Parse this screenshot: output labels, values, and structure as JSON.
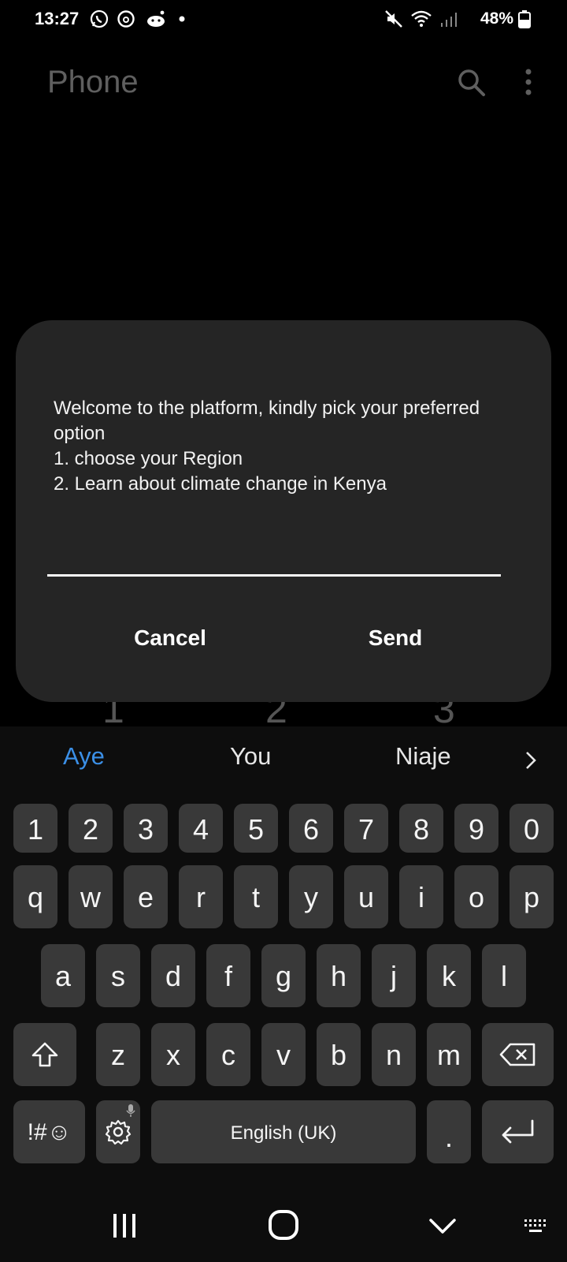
{
  "status_bar": {
    "time": "13:27",
    "battery": "48%"
  },
  "app": {
    "title": "Phone"
  },
  "dialer_digits": [
    "1",
    "2",
    "3"
  ],
  "dialog": {
    "message": "Welcome to the platform, kindly pick your preferred option\n1. choose your Region\n2. Learn about climate change in Kenya",
    "input_value": "",
    "cancel_label": "Cancel",
    "send_label": "Send"
  },
  "keyboard": {
    "suggestions": [
      "Aye",
      "You",
      "Niaje"
    ],
    "number_row": [
      "1",
      "2",
      "3",
      "4",
      "5",
      "6",
      "7",
      "8",
      "9",
      "0"
    ],
    "row1": [
      "q",
      "w",
      "e",
      "r",
      "t",
      "y",
      "u",
      "i",
      "o",
      "p"
    ],
    "row2": [
      "a",
      "s",
      "d",
      "f",
      "g",
      "h",
      "j",
      "k",
      "l"
    ],
    "row3": [
      "z",
      "x",
      "c",
      "v",
      "b",
      "n",
      "m"
    ],
    "symbols_label": "!#☺",
    "space_label": "English (UK)",
    "period_label": ".",
    "accent_color": "#3b8fe6"
  }
}
